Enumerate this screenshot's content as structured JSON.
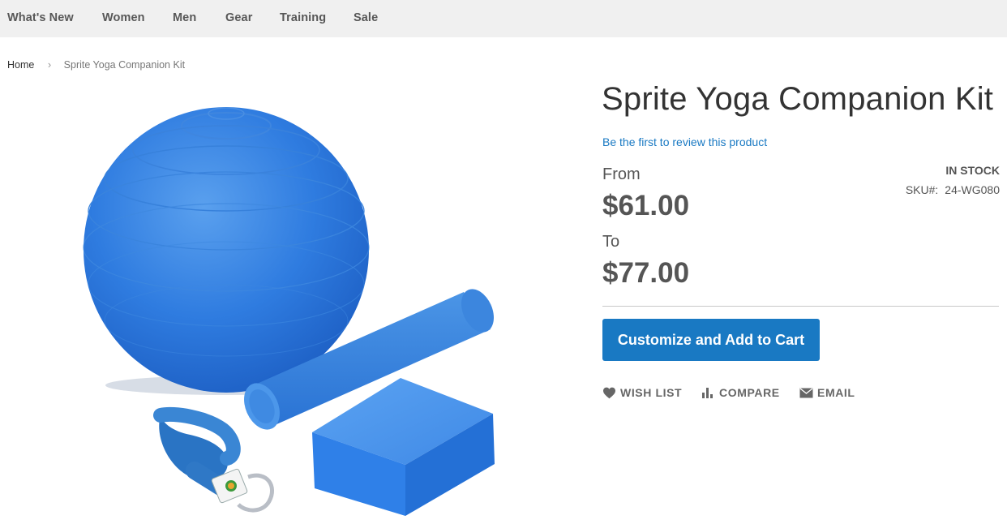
{
  "nav": {
    "items": [
      {
        "label": "What's New"
      },
      {
        "label": "Women"
      },
      {
        "label": "Men"
      },
      {
        "label": "Gear"
      },
      {
        "label": "Training"
      },
      {
        "label": "Sale"
      }
    ]
  },
  "breadcrumb": {
    "home": "Home",
    "current": "Sprite Yoga Companion Kit"
  },
  "product": {
    "title": "Sprite Yoga Companion Kit",
    "review_link": "Be the first to review this product",
    "price_from_label": "From",
    "price_from": "$61.00",
    "price_to_label": "To",
    "price_to": "$77.00",
    "stock": "IN STOCK",
    "sku_label": "SKU#:",
    "sku": "24-WG080",
    "image_icon": "yoga-kit-product-image"
  },
  "actions": {
    "add_to_cart": "Customize and Add to Cart",
    "wishlist": "WISH LIST",
    "compare": "COMPARE",
    "email": "EMAIL"
  },
  "colors": {
    "primary": "#1979c3",
    "nav_bg": "#f0f0f0",
    "text": "#333333"
  }
}
